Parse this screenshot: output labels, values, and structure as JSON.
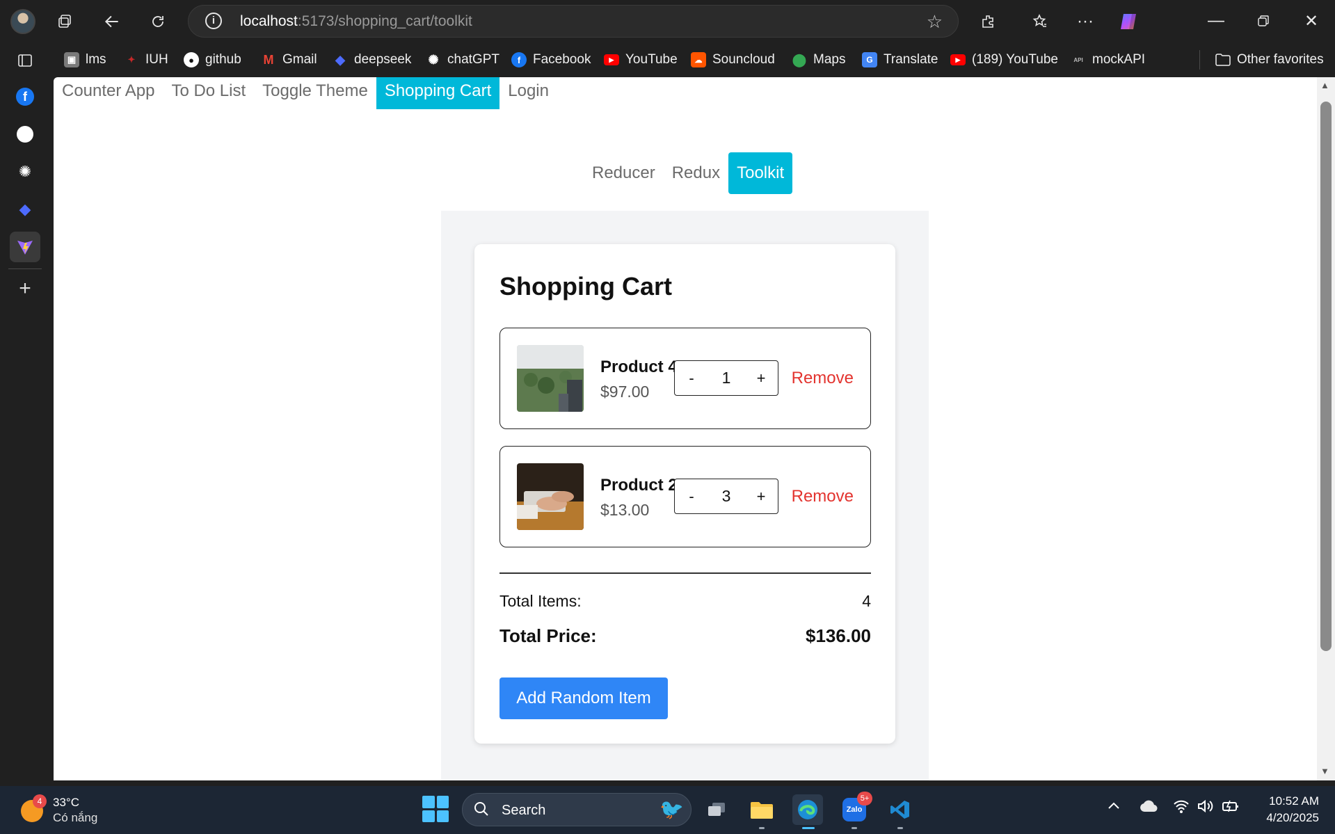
{
  "browser": {
    "url_host": "localhost",
    "url_path": ":5173/shopping_cart/toolkit",
    "favorites": [
      {
        "label": "lms",
        "icon": "lms-icon",
        "color": "#7a7a7a"
      },
      {
        "label": "IUH",
        "icon": "iuh-icon",
        "color": "#c62828"
      },
      {
        "label": "github",
        "icon": "github-icon",
        "color": "#ffffff"
      },
      {
        "label": "Gmail",
        "icon": "gmail-icon",
        "color": "#ea4335"
      },
      {
        "label": "deepseek",
        "icon": "deepseek-icon",
        "color": "#4d6bfe"
      },
      {
        "label": "chatGPT",
        "icon": "chatgpt-icon",
        "color": "#ffffff"
      },
      {
        "label": "Facebook",
        "icon": "facebook-icon",
        "color": "#1877f2"
      },
      {
        "label": "YouTube",
        "icon": "youtube-icon",
        "color": "#ff0000"
      },
      {
        "label": "Souncloud",
        "icon": "soundcloud-icon",
        "color": "#ff5500"
      },
      {
        "label": "Maps",
        "icon": "maps-icon",
        "color": "#34a853"
      },
      {
        "label": "Translate",
        "icon": "translate-icon",
        "color": "#4285f4"
      },
      {
        "label": "(189) YouTube",
        "icon": "youtube-icon",
        "color": "#ff0000"
      },
      {
        "label": "mockAPI",
        "icon": "mockapi-icon",
        "color": "#555555"
      }
    ],
    "other_favorites": "Other favorites"
  },
  "app": {
    "top_nav": [
      "Counter App",
      "To Do List",
      "Toggle Theme",
      "Shopping Cart",
      "Login"
    ],
    "top_nav_active": "Shopping Cart",
    "sub_nav": [
      "Reducer",
      "Redux",
      "Toolkit"
    ],
    "sub_nav_active": "Toolkit",
    "accent_color": "#00b8d9"
  },
  "cart": {
    "title": "Shopping Cart",
    "items": [
      {
        "name": "Product 4",
        "price": "$97.00",
        "quantity": "1",
        "minus": "-",
        "plus": "+",
        "remove": "Remove"
      },
      {
        "name": "Product 2",
        "price": "$13.00",
        "quantity": "3",
        "minus": "-",
        "plus": "+",
        "remove": "Remove"
      }
    ],
    "total_items_label": "Total Items:",
    "total_items_value": "4",
    "total_price_label": "Total Price:",
    "total_price_value": "$136.00",
    "add_button": "Add Random Item",
    "remove_color": "#e3342f",
    "button_color": "#2f86f6"
  },
  "taskbar": {
    "weather_badge": "4",
    "temperature": "33°C",
    "condition": "Có nắng",
    "search_label": "Search",
    "zalo_badge": "5+",
    "zalo_label": "Zalo",
    "time": "10:52 AM",
    "date": "4/20/2025"
  }
}
